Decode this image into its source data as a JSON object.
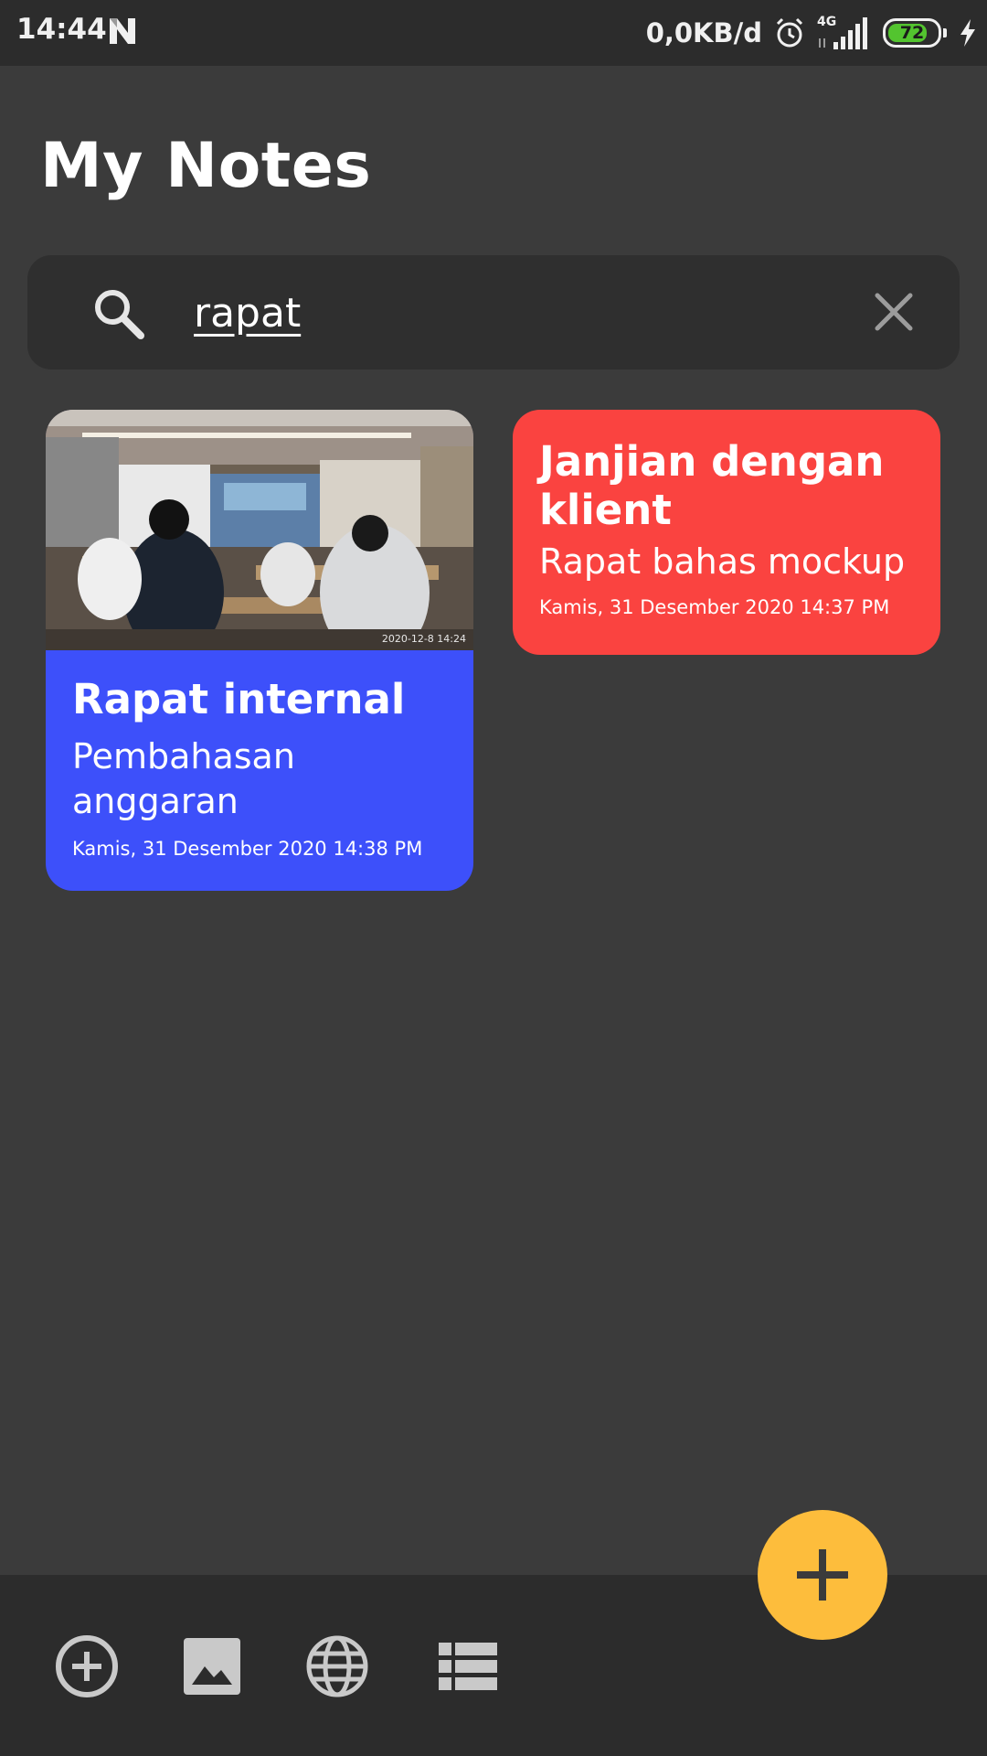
{
  "status_bar": {
    "time": "14:44",
    "network_speed": "0,0KB/d",
    "network_type": "4G",
    "battery_level": "72",
    "icons": [
      "n-app-icon",
      "alarm-icon",
      "signal-icon",
      "battery-icon",
      "charging-icon"
    ]
  },
  "header": {
    "title": "My Notes"
  },
  "search": {
    "query": "rapat",
    "icon": "search-icon",
    "clear_icon": "close-icon"
  },
  "notes": [
    {
      "title": "Rapat internal",
      "subtitle": "Pembahasan anggaran",
      "date": "Kamis, 31 Desember 2020 14:38 PM",
      "color": "#3d50fa",
      "image_stamp": "2020-12-8 14:24"
    },
    {
      "title": "Janjian dengan klient",
      "subtitle": "Rapat bahas mockup",
      "date": "Kamis, 31 Desember 2020 14:37 PM",
      "color": "#fa4340"
    }
  ],
  "bottom_bar": {
    "actions": [
      "add-circle-icon",
      "image-icon",
      "globe-icon",
      "list-icon"
    ]
  },
  "fab": {
    "icon": "plus-icon",
    "color": "#fdbd3c"
  }
}
